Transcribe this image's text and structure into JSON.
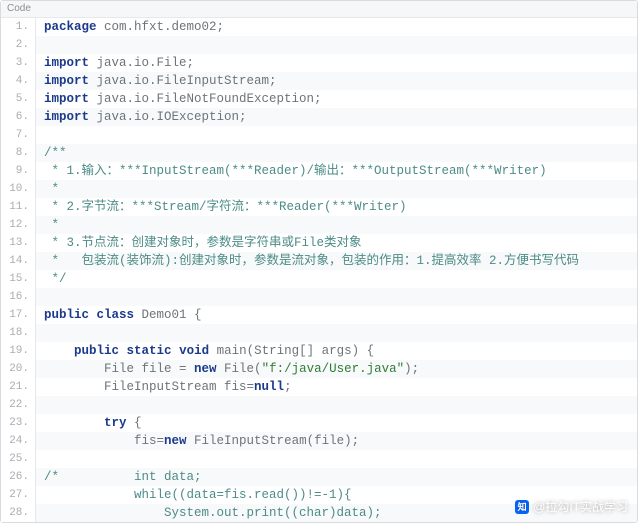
{
  "header_label": "Code",
  "watermark": {
    "logo_text": "知",
    "text": "@拉勾IT实战学习"
  },
  "lines": [
    {
      "n": "1.",
      "tokens": [
        {
          "t": "package",
          "c": "kw"
        },
        {
          "t": " com.hfxt.demo02;",
          "c": "pl"
        }
      ]
    },
    {
      "n": "2.",
      "tokens": []
    },
    {
      "n": "3.",
      "tokens": [
        {
          "t": "import",
          "c": "kw"
        },
        {
          "t": " java.io.File;",
          "c": "pl"
        }
      ]
    },
    {
      "n": "4.",
      "tokens": [
        {
          "t": "import",
          "c": "kw"
        },
        {
          "t": " java.io.FileInputStream;",
          "c": "pl"
        }
      ]
    },
    {
      "n": "5.",
      "tokens": [
        {
          "t": "import",
          "c": "kw"
        },
        {
          "t": " java.io.FileNotFoundException;",
          "c": "pl"
        }
      ]
    },
    {
      "n": "6.",
      "tokens": [
        {
          "t": "import",
          "c": "kw"
        },
        {
          "t": " java.io.IOException;",
          "c": "pl"
        }
      ]
    },
    {
      "n": "7.",
      "tokens": []
    },
    {
      "n": "8.",
      "tokens": [
        {
          "t": "/**",
          "c": "cmt"
        }
      ]
    },
    {
      "n": "9.",
      "tokens": [
        {
          "t": " * 1.输入：***InputStream(***Reader)/输出：***OutputStream(***Writer)",
          "c": "cmt"
        }
      ]
    },
    {
      "n": "10.",
      "tokens": [
        {
          "t": " *",
          "c": "cmt"
        }
      ]
    },
    {
      "n": "11.",
      "tokens": [
        {
          "t": " * 2.字节流：***Stream/字符流：***Reader(***Writer)",
          "c": "cmt"
        }
      ]
    },
    {
      "n": "12.",
      "tokens": [
        {
          "t": " *",
          "c": "cmt"
        }
      ]
    },
    {
      "n": "13.",
      "tokens": [
        {
          "t": " * 3.节点流：创建对象时，参数是字符串或File类对象",
          "c": "cmt"
        }
      ]
    },
    {
      "n": "14.",
      "tokens": [
        {
          "t": " *   包装流(装饰流):创建对象时，参数是流对象，包装的作用：1.提高效率 2.方便书写代码",
          "c": "cmt"
        }
      ]
    },
    {
      "n": "15.",
      "tokens": [
        {
          "t": " */",
          "c": "cmt"
        }
      ]
    },
    {
      "n": "16.",
      "tokens": []
    },
    {
      "n": "17.",
      "tokens": [
        {
          "t": "public",
          "c": "kw"
        },
        {
          "t": " ",
          "c": "pl"
        },
        {
          "t": "class",
          "c": "kw"
        },
        {
          "t": " Demo01 {",
          "c": "pl"
        }
      ]
    },
    {
      "n": "18.",
      "tokens": []
    },
    {
      "n": "19.",
      "tokens": [
        {
          "t": "    ",
          "c": "pl"
        },
        {
          "t": "public",
          "c": "kw"
        },
        {
          "t": " ",
          "c": "pl"
        },
        {
          "t": "static",
          "c": "kw"
        },
        {
          "t": " ",
          "c": "pl"
        },
        {
          "t": "void",
          "c": "kw"
        },
        {
          "t": " main(String[] args) {",
          "c": "pl"
        }
      ]
    },
    {
      "n": "20.",
      "tokens": [
        {
          "t": "        File file = ",
          "c": "pl"
        },
        {
          "t": "new",
          "c": "kw"
        },
        {
          "t": " File(",
          "c": "pl"
        },
        {
          "t": "\"f:/java/User.java\"",
          "c": "str"
        },
        {
          "t": ");",
          "c": "pl"
        }
      ]
    },
    {
      "n": "21.",
      "tokens": [
        {
          "t": "        FileInputStream fis=",
          "c": "pl"
        },
        {
          "t": "null",
          "c": "kw"
        },
        {
          "t": ";",
          "c": "pl"
        }
      ]
    },
    {
      "n": "22.",
      "tokens": []
    },
    {
      "n": "23.",
      "tokens": [
        {
          "t": "        ",
          "c": "pl"
        },
        {
          "t": "try",
          "c": "kw"
        },
        {
          "t": " {",
          "c": "pl"
        }
      ]
    },
    {
      "n": "24.",
      "tokens": [
        {
          "t": "            fis=",
          "c": "pl"
        },
        {
          "t": "new",
          "c": "kw"
        },
        {
          "t": " FileInputStream(file);",
          "c": "pl"
        }
      ]
    },
    {
      "n": "25.",
      "tokens": []
    },
    {
      "n": "26.",
      "tokens": [
        {
          "t": "/*          int data;",
          "c": "cmt"
        }
      ]
    },
    {
      "n": "27.",
      "tokens": [
        {
          "t": "            while((data=fis.read())!=-1){",
          "c": "cmt"
        }
      ]
    },
    {
      "n": "28.",
      "tokens": [
        {
          "t": "                System.out.print((char)data);",
          "c": "cmt"
        }
      ]
    }
  ]
}
